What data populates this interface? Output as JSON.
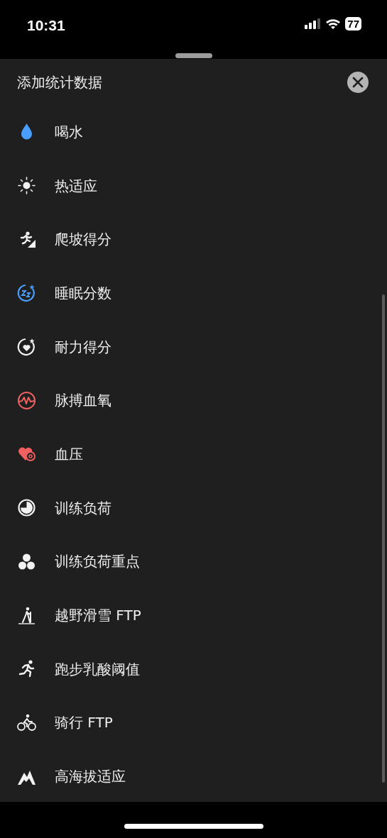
{
  "status_bar": {
    "time": "10:31",
    "battery": "77"
  },
  "sheet": {
    "title": "添加统计数据"
  },
  "items": [
    {
      "label": "喝水",
      "kind": "drop"
    },
    {
      "label": "热适应",
      "kind": "sun"
    },
    {
      "label": "爬坡得分",
      "kind": "climb"
    },
    {
      "label": "睡眠分数",
      "kind": "sleep"
    },
    {
      "label": "耐力得分",
      "kind": "heartstar"
    },
    {
      "label": "脉搏血氧",
      "kind": "pulse"
    },
    {
      "label": "血压",
      "kind": "pressure"
    },
    {
      "label": "训练负荷",
      "kind": "gauge"
    },
    {
      "label": "训练负荷重点",
      "kind": "circles"
    },
    {
      "label": "越野滑雪 FTP",
      "kind": "ski"
    },
    {
      "label": "跑步乳酸阈值",
      "kind": "run"
    },
    {
      "label": "骑行 FTP",
      "kind": "bike"
    },
    {
      "label": "高海拔适应",
      "kind": "mountain"
    }
  ]
}
